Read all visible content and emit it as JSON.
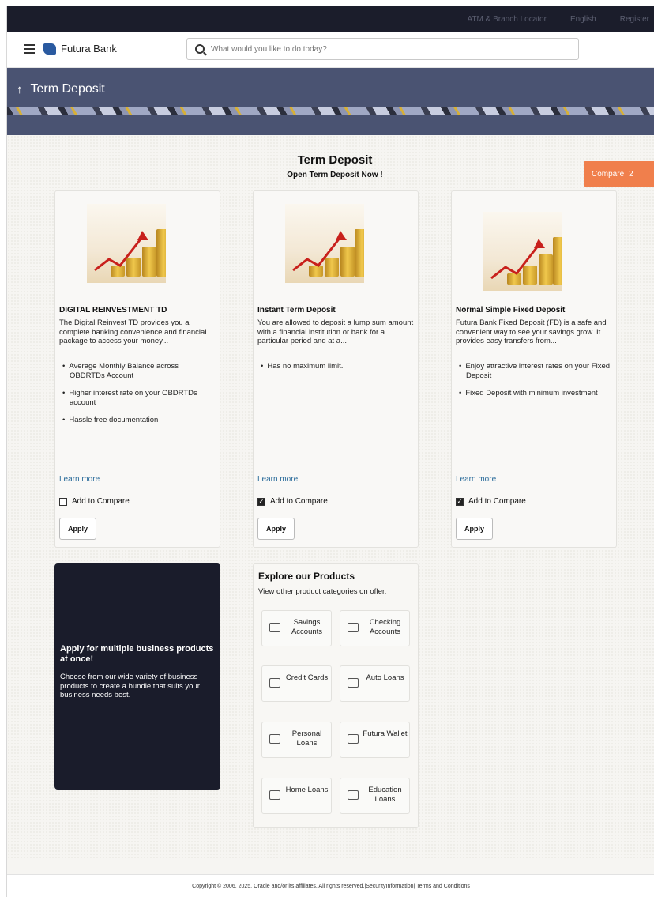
{
  "topbar": {
    "items": [
      "ATM & Branch Locator",
      "English",
      "Register"
    ]
  },
  "header": {
    "brand": "Futura Bank",
    "search_placeholder": "What would you like to do today?"
  },
  "banner": {
    "title": "Term Deposit"
  },
  "section": {
    "title": "Term Deposit",
    "subtitle": "Open Term Deposit Now !"
  },
  "compare": {
    "label": "Compare",
    "count": "2"
  },
  "cards": [
    {
      "title": "DIGITAL REINVESTMENT TD",
      "description": "The Digital Reinvest TD provides you a complete banking convenience and financial package to access your money...",
      "features": [
        "Average Monthly Balance across OBDRTDs Account",
        "Higher interest rate on your OBDRTDs account",
        "Hassle free documentation"
      ],
      "learn_more": "Learn more",
      "compare_label": "Add to Compare",
      "checked": false,
      "apply": "Apply"
    },
    {
      "title": "Instant Term Deposit",
      "description": "You are allowed to deposit a lump sum amount with a financial institution or bank for a particular period and at a...",
      "features": [
        "Has no maximum limit."
      ],
      "learn_more": "Learn more",
      "compare_label": "Add to Compare",
      "checked": true,
      "apply": "Apply"
    },
    {
      "title": "Normal Simple Fixed Deposit",
      "description": "Futura Bank Fixed Deposit (FD) is a safe and convenient way to see your savings grow. It provides easy transfers from...",
      "features": [
        "Enjoy attractive interest rates on your Fixed Deposit",
        "Fixed Deposit with minimum investment"
      ],
      "learn_more": "Learn more",
      "compare_label": "Add to Compare",
      "checked": true,
      "apply": "Apply"
    }
  ],
  "promo": {
    "title": "Apply for multiple business products at once!",
    "text": "Choose from our wide variety of business products to create a bundle that suits your business needs best."
  },
  "explore": {
    "title": "Explore our Products",
    "subtitle": "View other product categories on offer.",
    "tiles": [
      {
        "label": "Savings Accounts",
        "icon": "savings-icon"
      },
      {
        "label": "Checking Accounts",
        "icon": "checking-icon"
      },
      {
        "label": "Credit Cards",
        "icon": "credit-card-icon"
      },
      {
        "label": "Auto Loans",
        "icon": "car-icon"
      },
      {
        "label": "Personal Loans",
        "icon": "personal-loan-icon"
      },
      {
        "label": "Futura Wallet",
        "icon": "wallet-icon"
      },
      {
        "label": "Home Loans",
        "icon": "home-icon"
      },
      {
        "label": "Education Loans",
        "icon": "book-icon"
      }
    ]
  },
  "footer": {
    "text": "Copyright © 2006, 2025, Oracle and/or its affiliates. All rights reserved.|SecurityInformation| Terms and Conditions"
  }
}
